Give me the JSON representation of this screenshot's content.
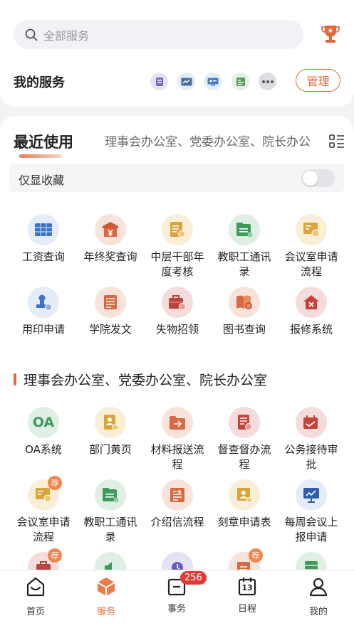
{
  "search": {
    "placeholder": "全部服务"
  },
  "my_services": {
    "title": "我的服务",
    "manage_label": "管理"
  },
  "recent": {
    "title": "最近使用",
    "subtitle": "理事会办公室、党委办公室、院长办公",
    "favorites_only_label": "仅显收藏",
    "favorites_only_on": false,
    "items": [
      {
        "label": "工资查询",
        "icon": "salary-table-icon"
      },
      {
        "label": "年终奖查询",
        "icon": "bonus-yen-icon"
      },
      {
        "label": "中层干部年度考核",
        "icon": "cadre-assessment-icon"
      },
      {
        "label": "教职工通讯录",
        "icon": "staff-contacts-icon"
      },
      {
        "label": "会议室申请流程",
        "icon": "meeting-room-icon"
      },
      {
        "label": "用印申请",
        "icon": "seal-stamp-icon"
      },
      {
        "label": "学院发文",
        "icon": "document-issue-icon"
      },
      {
        "label": "失物招领",
        "icon": "lost-found-icon"
      },
      {
        "label": "图书查询",
        "icon": "book-search-icon"
      },
      {
        "label": "报修系统",
        "icon": "repair-house-icon"
      }
    ]
  },
  "office_section": {
    "title": "理事会办公室、党委办公室、院长办公室",
    "items": [
      {
        "label": "OA系统",
        "icon": "oa-text-icon",
        "icon_text": "OA",
        "recommended": false
      },
      {
        "label": "部门黄页",
        "icon": "yellow-pages-icon",
        "recommended": false
      },
      {
        "label": "材料报送流程",
        "icon": "folder-submit-icon",
        "recommended": false
      },
      {
        "label": "督查督办流程",
        "icon": "supervision-icon",
        "recommended": false
      },
      {
        "label": "公务接待审批",
        "icon": "reception-approval-icon",
        "recommended": false
      },
      {
        "label": "会议室申请流程",
        "icon": "meeting-room-icon",
        "recommended": true
      },
      {
        "label": "教职工通讯录",
        "icon": "staff-contacts-icon",
        "recommended": false
      },
      {
        "label": "介绍信流程",
        "icon": "introduction-letter-icon",
        "recommended": false
      },
      {
        "label": "刻章申请表",
        "icon": "seal-application-icon",
        "recommended": false
      },
      {
        "label": "每周会议上报申请",
        "icon": "weekly-meeting-icon",
        "recommended": false
      }
    ],
    "recommend_badge": "荐"
  },
  "tabbar": {
    "tabs": [
      {
        "label": "首页",
        "icon": "home-icon"
      },
      {
        "label": "服务",
        "icon": "service-cube-icon",
        "active": true
      },
      {
        "label": "事务",
        "icon": "affairs-icon",
        "count": "256"
      },
      {
        "label": "日程",
        "icon": "calendar-icon",
        "day": "13"
      },
      {
        "label": "我的",
        "icon": "profile-icon"
      }
    ]
  },
  "colors": {
    "accent": "#e06a3c",
    "badge": "#e53935"
  }
}
